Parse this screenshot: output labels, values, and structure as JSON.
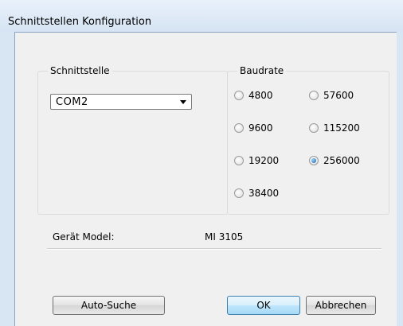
{
  "window": {
    "title": "Schnittstellen Konfiguration"
  },
  "interface_group": {
    "legend": "Schnittstelle",
    "selected_port": "COM2"
  },
  "baudrate_group": {
    "legend": "Baudrate",
    "options": [
      {
        "label": "4800",
        "checked": false
      },
      {
        "label": "57600",
        "checked": false
      },
      {
        "label": "9600",
        "checked": false
      },
      {
        "label": "115200",
        "checked": false
      },
      {
        "label": "19200",
        "checked": false
      },
      {
        "label": "256000",
        "checked": true
      },
      {
        "label": "38400",
        "checked": false
      }
    ]
  },
  "device": {
    "label": "Gerät Model:",
    "value": "MI 3105"
  },
  "buttons": {
    "auto_search": "Auto-Suche",
    "ok": "OK",
    "cancel": "Abbrechen"
  }
}
